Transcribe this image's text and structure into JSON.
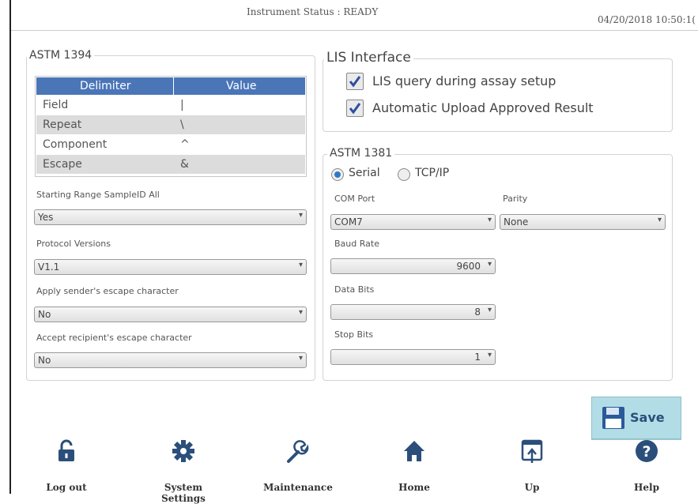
{
  "header": {
    "status": "Instrument Status : READY",
    "datetime": "04/20/2018 10:50:1("
  },
  "astm1394": {
    "title": "ASTM 1394",
    "table": {
      "headers": [
        "Delimiter",
        "Value"
      ],
      "rows": [
        {
          "delimiter": "Field",
          "value": "|"
        },
        {
          "delimiter": "Repeat",
          "value": "\\"
        },
        {
          "delimiter": "Component",
          "value": "^"
        },
        {
          "delimiter": "Escape",
          "value": "&"
        }
      ]
    },
    "starting_range": {
      "label": "Starting Range SampleID All",
      "value": "Yes"
    },
    "protocol_versions": {
      "label": "Protocol Versions",
      "value": "V1.1"
    },
    "apply_sender_escape": {
      "label": "Apply sender's escape character",
      "value": "No"
    },
    "accept_recipient_escape": {
      "label": "Accept recipient's escape character",
      "value": "No"
    }
  },
  "lis_interface": {
    "title": "LIS Interface",
    "lis_query": {
      "label": "LIS query during assay setup",
      "checked": true
    },
    "auto_upload": {
      "label": "Automatic Upload Approved Result",
      "checked": true
    }
  },
  "astm1381": {
    "title": "ASTM 1381",
    "connection": {
      "serial_label": "Serial",
      "tcpip_label": "TCP/IP",
      "selected": "Serial"
    },
    "com_port": {
      "label": "COM Port",
      "value": "COM7"
    },
    "parity": {
      "label": "Parity",
      "value": "None"
    },
    "baud_rate": {
      "label": "Baud Rate",
      "value": "9600"
    },
    "data_bits": {
      "label": "Data Bits",
      "value": "8"
    },
    "stop_bits": {
      "label": "Stop Bits",
      "value": "1"
    }
  },
  "save_label": "Save",
  "nav": [
    {
      "label": "Log out",
      "icon": "unlock-icon"
    },
    {
      "label": "System Settings",
      "icon": "gear-icon"
    },
    {
      "label": "Maintenance",
      "icon": "wrench-icon"
    },
    {
      "label": "Home",
      "icon": "home-icon"
    },
    {
      "label": "Up",
      "icon": "upload-window-icon"
    },
    {
      "label": "Help",
      "icon": "help-icon"
    }
  ],
  "colors": {
    "accent": "#4a76b8",
    "save_bg": "#b3dde6",
    "icon": "#2b4f7a"
  }
}
